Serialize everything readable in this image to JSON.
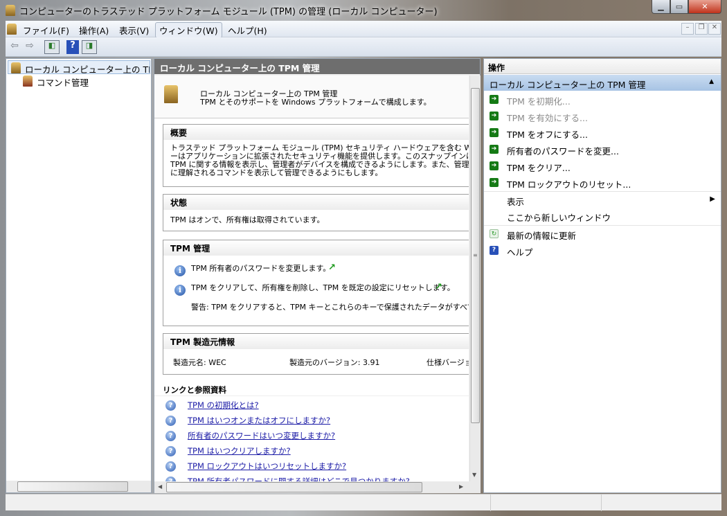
{
  "window": {
    "title": "コンピューターのトラステッド プラットフォーム モジュール (TPM) の管理 (ローカル コンピューター)"
  },
  "menu": [
    "ファイル(F)",
    "操作(A)",
    "表示(V)",
    "ウィンドウ(W)",
    "ヘルプ(H)"
  ],
  "toolbar": {
    "help": "?"
  },
  "tree": [
    "ローカル コンピューター上の TPM 管理",
    "コマンド管理"
  ],
  "center": {
    "header": "ローカル コンピューター上の TPM 管理",
    "intro_title": "ローカル コンピューター上の TPM 管理",
    "intro_sub": "TPM とそのサポートを Windows プラットフォームで構成します。",
    "overview": {
      "title": "概要",
      "lines": [
        "トラステッド プラットフォーム モジュール (TPM) セキュリティ ハードウェアを含む Windows コンピュ",
        "ーはアプリケーションに拡張されたセキュリティ機能を提供します。このスナップインは、コンピュー",
        "TPM に関する情報を表示し、管理者がデバイスを構成できるようにします。また、管理者がデ",
        "に理解されるコマンドを表示して管理できるようにもします。"
      ]
    },
    "status": {
      "title": "状態",
      "text": "TPM はオンで、所有権は取得されています。"
    },
    "manage": {
      "title": "TPM 管理",
      "item1": "TPM 所有者のパスワードを変更します。",
      "item2": "TPM をクリアして、所有権を削除し、TPM を既定の設定にリセットします。",
      "warning": "警告: TPM をクリアすると、TPM キーとこれらのキーで保護されたデータがすべて失われます"
    },
    "maker": {
      "title": "TPM 製造元情報",
      "name": "製造元名: WEC",
      "version": "製造元のバージョン: 3.91",
      "spec": "仕様バージョン"
    },
    "links": {
      "title": "リンクと参照資料",
      "items": [
        "TPM の初期化とは?",
        "TPM はいつオンまたはオフにしますか?",
        "所有者のパスワードはいつ変更しますか?",
        "TPM はいつクリアしますか?",
        "TPM ロックアウトはいつリセットしますか?",
        "TPM 所有者パスワードに関する詳細はどこで見つかりますか?"
      ]
    }
  },
  "actions": {
    "header": "操作",
    "group": "ローカル コンピューター上の TPM 管理",
    "items": [
      "TPM を初期化...",
      "TPM を有効にする...",
      "TPM をオフにする...",
      "所有者のパスワードを変更...",
      "TPM をクリア...",
      "TPM ロックアウトのリセット...",
      "表示",
      "ここから新しいウィンドウ",
      "最新の情報に更新",
      "ヘルプ"
    ]
  }
}
